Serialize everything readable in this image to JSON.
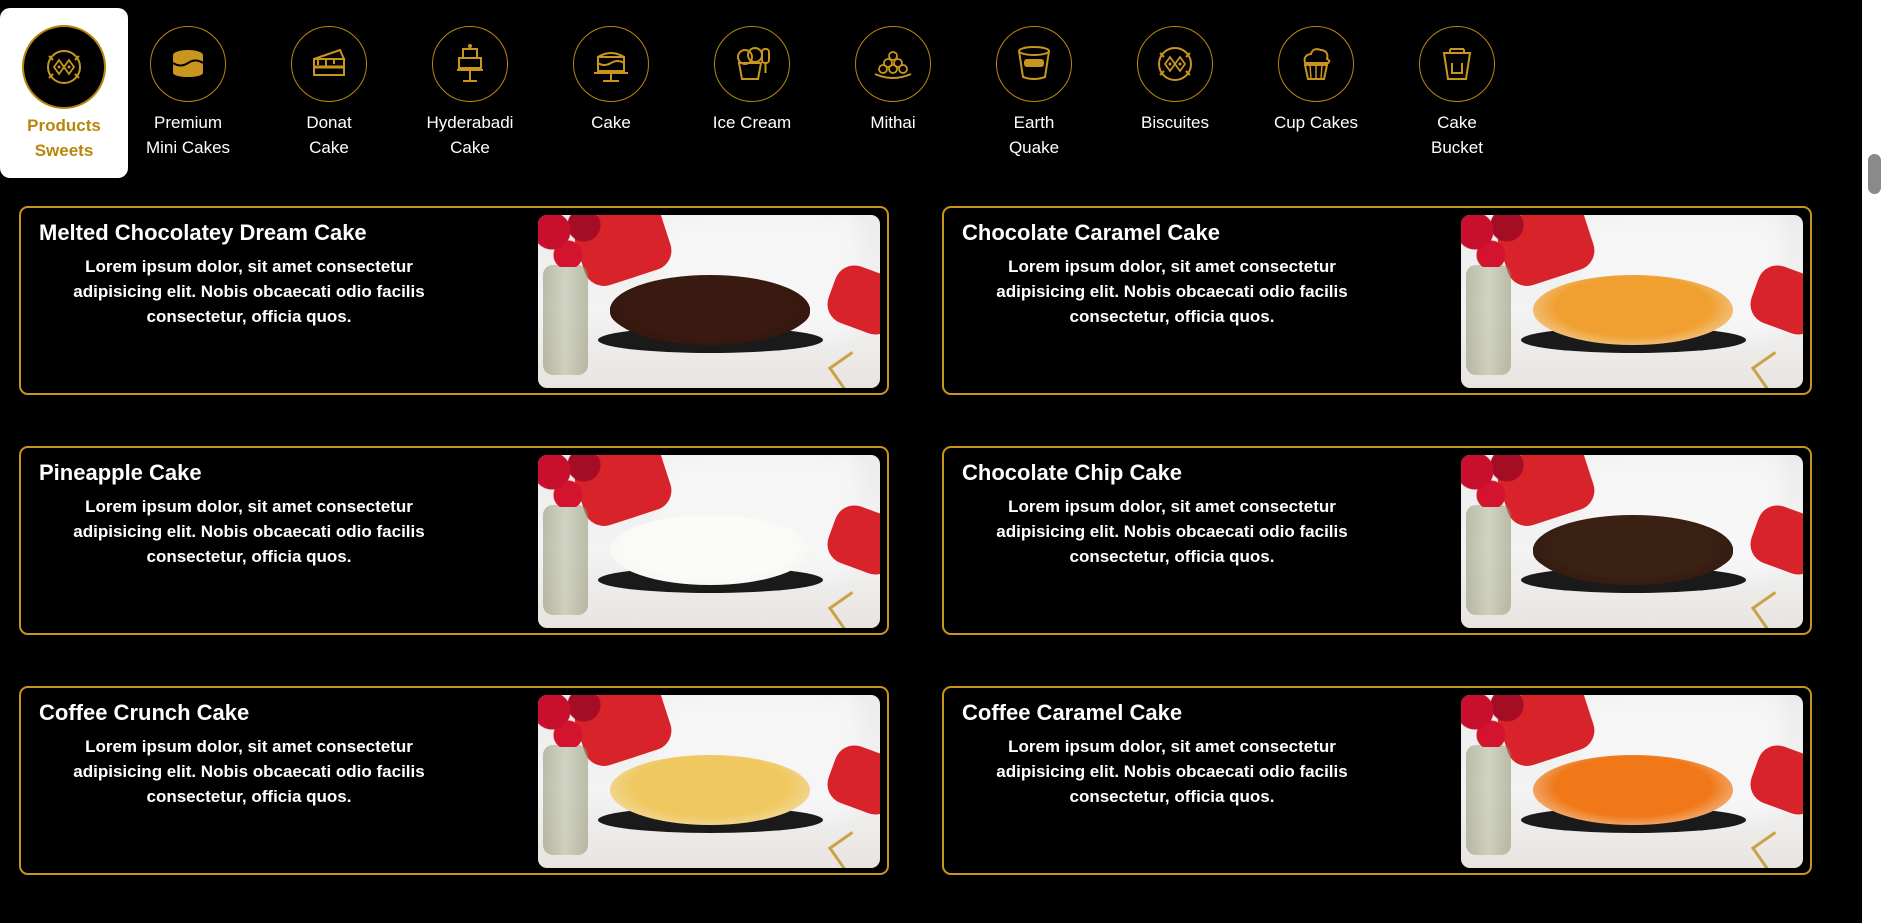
{
  "categories": [
    {
      "label": "Products\nSweets",
      "icon": "biscuit-plate-icon",
      "active": true
    },
    {
      "label": "Premium\nMini Cakes",
      "icon": "mini-cake-icon",
      "active": false
    },
    {
      "label": "Donat\nCake",
      "icon": "cake-slice-icon",
      "active": false
    },
    {
      "label": "Hyderabadi\nCake",
      "icon": "tiered-cake-icon",
      "active": false
    },
    {
      "label": "Cake",
      "icon": "cake-stand-icon",
      "active": false
    },
    {
      "label": "Ice Cream",
      "icon": "ice-cream-icon",
      "active": false
    },
    {
      "label": "Mithai",
      "icon": "mithai-plate-icon",
      "active": false
    },
    {
      "label": "Earth\nQuake",
      "icon": "bucket-tub-icon",
      "active": false
    },
    {
      "label": "Biscuites",
      "icon": "biscuit-plate-icon",
      "active": false
    },
    {
      "label": "Cup Cakes",
      "icon": "cupcake-icon",
      "active": false
    },
    {
      "label": "Cake\nBucket",
      "icon": "cake-bucket-icon",
      "active": false
    }
  ],
  "products": [
    {
      "title": "Melted Chocolatey Dream Cake",
      "desc": "Lorem ipsum dolor, sit amet consectetur adipisicing elit. Nobis obcaecati odio facilis consectetur, officia quos.",
      "cake_top": "#3a1a10",
      "cake_side": "#2a120a"
    },
    {
      "title": "Chocolate Caramel Cake",
      "desc": "Lorem ipsum dolor, sit amet consectetur adipisicing elit. Nobis obcaecati odio facilis consectetur, officia quos.",
      "cake_top": "#f0a030",
      "cake_side": "#f4eee2"
    },
    {
      "title": "Pineapple Cake",
      "desc": "Lorem ipsum dolor, sit amet consectetur adipisicing elit. Nobis obcaecati odio facilis consectetur, officia quos.",
      "cake_top": "#fbfbf8",
      "cake_side": "#f2f0ea"
    },
    {
      "title": "Chocolate Chip Cake",
      "desc": "Lorem ipsum dolor, sit amet consectetur adipisicing elit. Nobis obcaecati odio facilis consectetur, officia quos.",
      "cake_top": "#3b2014",
      "cake_side": "#2b150c"
    },
    {
      "title": "Coffee Crunch Cake",
      "desc": "Lorem ipsum dolor, sit amet consectetur adipisicing elit. Nobis obcaecati odio facilis consectetur, officia quos.",
      "cake_top": "#f0c860",
      "cake_side": "#f3ead8"
    },
    {
      "title": "Coffee Caramel Cake",
      "desc": "Lorem ipsum dolor, sit amet consectetur adipisicing elit. Nobis obcaecati odio facilis consectetur, officia quos.",
      "cake_top": "#f07818",
      "cake_side": "#f5efe6"
    }
  ],
  "colors": {
    "accent": "#c8961e",
    "background": "#000000"
  }
}
